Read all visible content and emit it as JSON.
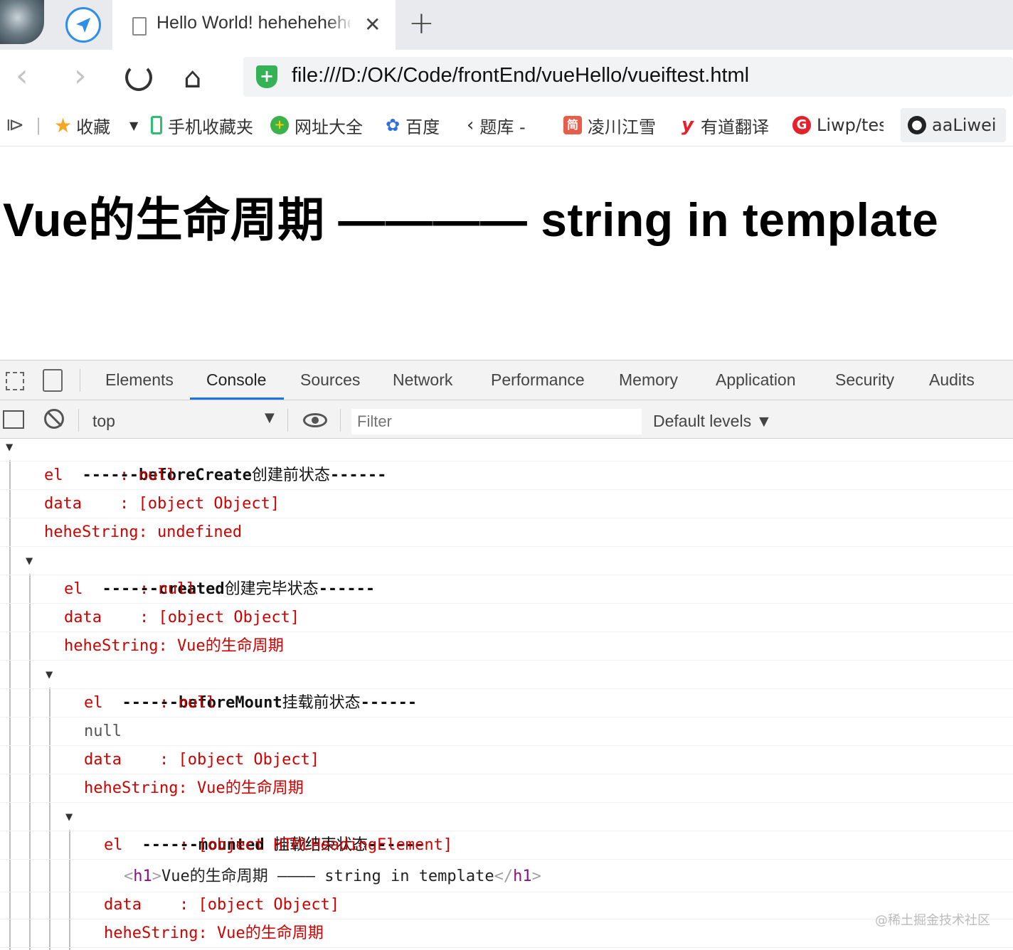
{
  "browser": {
    "tab_title": "Hello World! hehehehehe",
    "url": "file:///D:/OK/Code/frontEnd/vueHello/vueiftest.html"
  },
  "bookmarks": [
    {
      "label": "收藏",
      "icon": "star-icon",
      "color": "#f5a623"
    },
    {
      "label": "手机收藏夹",
      "icon": "phone-icon",
      "color": "#2fbf71"
    },
    {
      "label": "网址大全",
      "icon": "plus-globe-icon",
      "color": "#3bb34a"
    },
    {
      "label": "百度",
      "icon": "paw-icon",
      "color": "#2f6fe0"
    },
    {
      "label": "题库 -",
      "icon": "book-icon",
      "color": "#333333"
    },
    {
      "label": "凌川江雪",
      "icon": "jian-icon",
      "color": "#e85d4a"
    },
    {
      "label": "有道翻译",
      "icon": "youdao-icon",
      "color": "#e8202b"
    },
    {
      "label": "Liwp/tes",
      "icon": "g-icon",
      "color": "#e8202b"
    },
    {
      "label": "aaLiwei",
      "icon": "github-icon",
      "color": "#222222"
    }
  ],
  "page": {
    "heading": "Vue的生命周期 ———— string in template"
  },
  "devtools": {
    "tabs": [
      "Elements",
      "Console",
      "Sources",
      "Network",
      "Performance",
      "Memory",
      "Application",
      "Security",
      "Audits"
    ],
    "active_tab": "Console",
    "context": "top",
    "filter_placeholder": "Filter",
    "levels": "Default levels"
  },
  "console": {
    "g1": {
      "prefix": "------beforeCreate",
      "cn": "创建前状态",
      "suffix": "------"
    },
    "g1_el": "el      : null",
    "g1_data": "data    : [object Object]",
    "g1_hehe": "heheString: undefined",
    "g2": {
      "prefix": "------created",
      "cn": "创建完毕状态",
      "suffix": "------"
    },
    "g2_el": "el      : null",
    "g2_data": "data    : [object Object]",
    "g2_hehe_a": "heheString: Vue",
    "g2_hehe_b": "的生命周期",
    "g3": {
      "prefix": "------beforeMount",
      "cn": "挂载前状态",
      "suffix": "------"
    },
    "g3_el": "el      : null",
    "g3_null": "null",
    "g3_data": "data    : [object Object]",
    "g3_hehe_a": "heheString: Vue",
    "g3_hehe_b": "的生命周期",
    "g4": {
      "prefix": "------mounted ",
      "cn": "挂载结束状态",
      "suffix": "------"
    },
    "g4_el": "el      : [object HTMLHeadingElement]",
    "g4_node_open": "<",
    "g4_node_tag": "h1",
    "g4_node_close": ">",
    "g4_node_text_a": "Vue",
    "g4_node_text_b": "的生命周期",
    "g4_node_text_c": " ———— string in template",
    "g4_node_end": "</",
    "g4_node_end_tag": "h1",
    "g4_data": "data    : [object Object]",
    "g4_hehe_a": "heheString: Vue",
    "g4_hehe_b": "的生命周期"
  },
  "watermark": "@稀土掘金技术社区"
}
